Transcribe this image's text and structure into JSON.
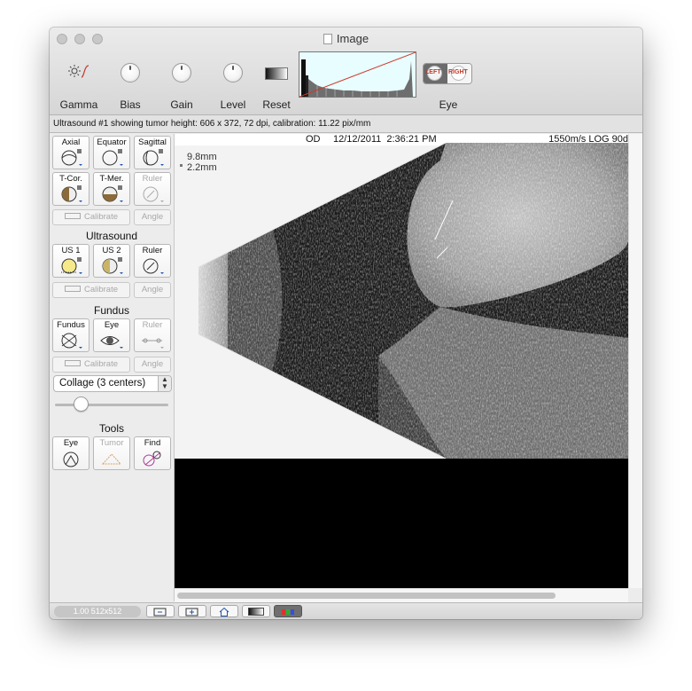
{
  "window": {
    "title": "Image"
  },
  "toolbar": {
    "gamma_label": "Gamma",
    "bias_label": "Bias",
    "gain_label": "Gain",
    "level_label": "Level",
    "reset_label": "Reset",
    "eye_label": "Eye",
    "eye_left": "LEFT",
    "eye_right": "RIGHT"
  },
  "status": {
    "text": "Ultrasound #1 showing tumor height: 606 x 372, 72 dpi, calibration: 11.22 pix/mm"
  },
  "sidebar": {
    "views": [
      "Axial",
      "Equator",
      "Sagittal",
      "T-Cor.",
      "T-Mer.",
      "Ruler"
    ],
    "calibrate_label": "Calibrate",
    "angle_label": "Angle",
    "ultrasound_title": "Ultrasound",
    "ultrasound_items": [
      "US 1",
      "US 2",
      "Ruler"
    ],
    "fundus_title": "Fundus",
    "fundus_items": [
      "Fundus",
      "Eye",
      "Ruler"
    ],
    "collage_value": "Collage (3 centers)",
    "tools_title": "Tools",
    "tools_items": [
      "Eye",
      "Tumor",
      "Find"
    ]
  },
  "image": {
    "eye_side": "OD",
    "datetime": "12/12/2011  2:36:21 PM",
    "settings": "1550m/s LOG 90d",
    "measure1": "9.8mm",
    "measure2": "2.2mm"
  },
  "bottom": {
    "zoom_text": "1.00 512x512"
  }
}
